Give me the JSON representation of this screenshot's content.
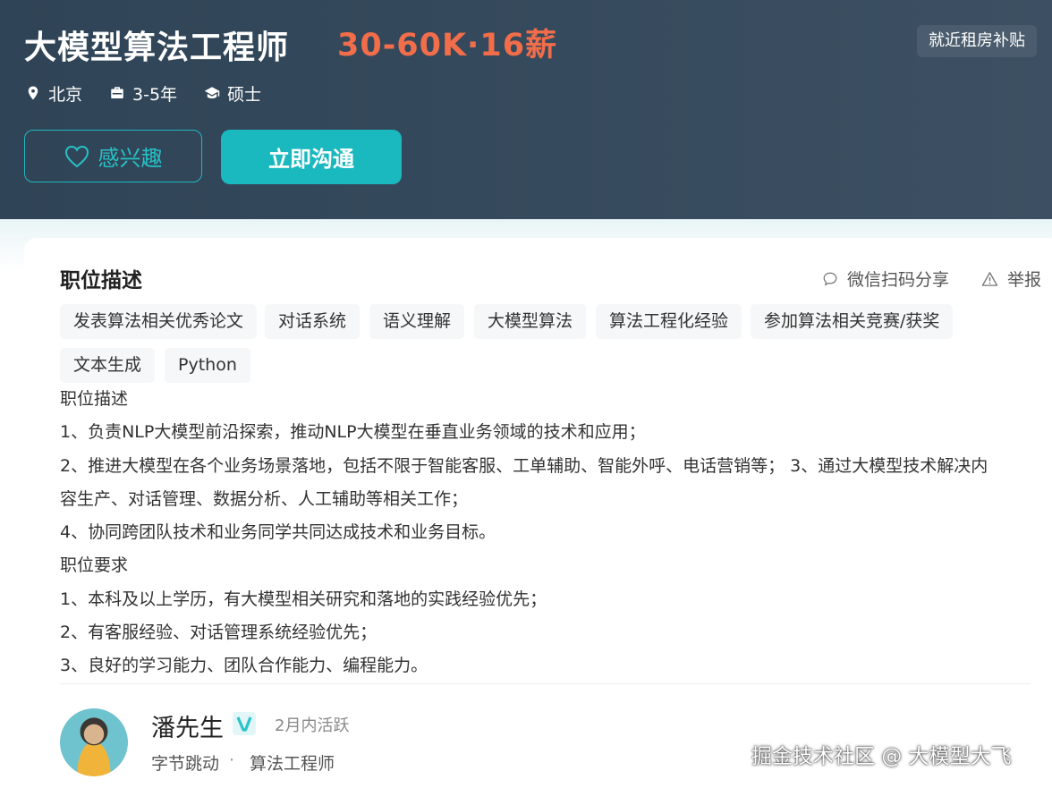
{
  "header": {
    "title": "大模型算法工程师",
    "salary": "30-60K·16薪",
    "perk": "就近租房补贴",
    "location": "北京",
    "experience": "3-5年",
    "degree": "硕士",
    "interest_button": "感兴趣",
    "chat_button": "立即沟通"
  },
  "section": {
    "title": "职位描述",
    "share": "微信扫码分享",
    "report": "举报"
  },
  "tags": [
    "发表算法相关优秀论文",
    "对话系统",
    "语义理解",
    "大模型算法",
    "算法工程化经验",
    "参加算法相关竞赛/获奖",
    "文本生成",
    "Python"
  ],
  "description": [
    "职位描述",
    "1、负责NLP大模型前沿探索，推动NLP大模型在垂直业务领域的技术和应用；",
    "2、推进大模型在各个业务场景落地，包括不限于智能客服、工单辅助、智能外呼、电话营销等； 3、通过大模型技术解决内",
    "容生产、对话管理、数据分析、人工辅助等相关工作；",
    "4、协同跨团队技术和业务同学共同达成技术和业务目标。",
    "职位要求",
    "1、本科及以上学历，有大模型相关研究和落地的实践经验优先；",
    "2、有客服经验、对话管理系统经验优先；",
    "3、良好的学习能力、团队合作能力、编程能力。"
  ],
  "recruiter": {
    "name": "潘先生",
    "verified_icon": "verified-v-icon",
    "active": "2月内活跃",
    "company": "字节跳动",
    "separator": "·",
    "role": "算法工程师"
  },
  "watermark": "掘金技术社区 @ 大模型大飞",
  "colors": {
    "header_bg": "#35495c",
    "salary": "#f26d4a",
    "accent": "#1ab8bf"
  }
}
